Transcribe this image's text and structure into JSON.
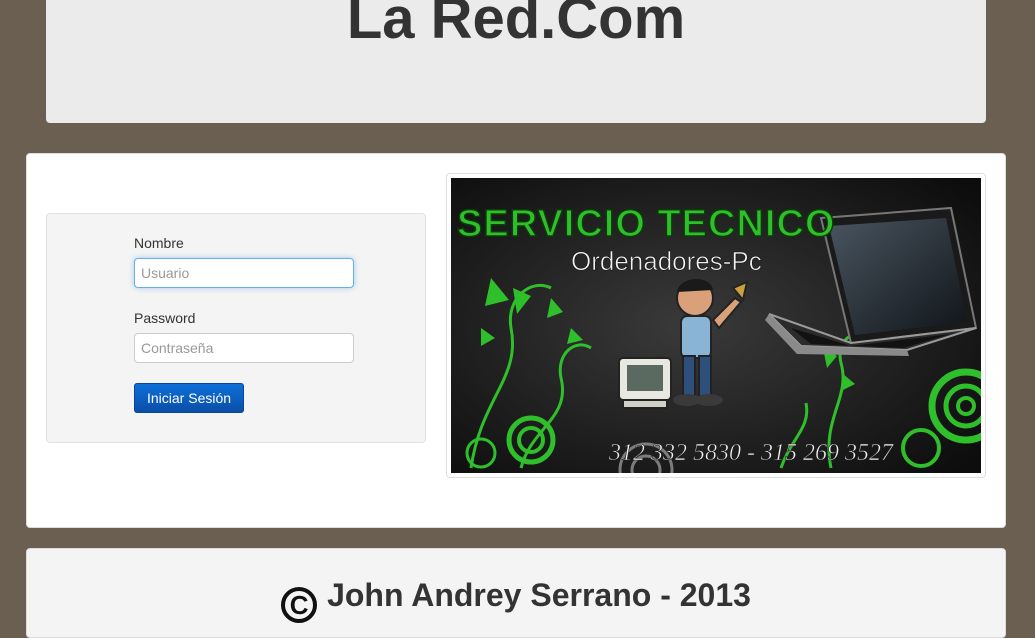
{
  "header": {
    "title": "La Red.Com"
  },
  "login": {
    "name_label": "Nombre",
    "name_placeholder": "Usuario",
    "name_value": "",
    "password_label": "Password",
    "password_placeholder": "Contraseña",
    "password_value": "",
    "submit_label": "Iniciar Sesión"
  },
  "banner": {
    "headline": "SERVICIO TECNICO",
    "subheadline": "Ordenadores-Pc",
    "phones": "312 332 5830 - 315 269 3527"
  },
  "footer": {
    "copyright_symbol": "C",
    "text": "John Andrey Serrano - 2013"
  },
  "colors": {
    "page_background": "#6b5f52",
    "panel_background": "#ebebeb",
    "button_primary": "#0a5cc2",
    "banner_green": "#2fbf2a",
    "focus_border": "#66afe9"
  },
  "icons": [
    "copyright-icon"
  ]
}
